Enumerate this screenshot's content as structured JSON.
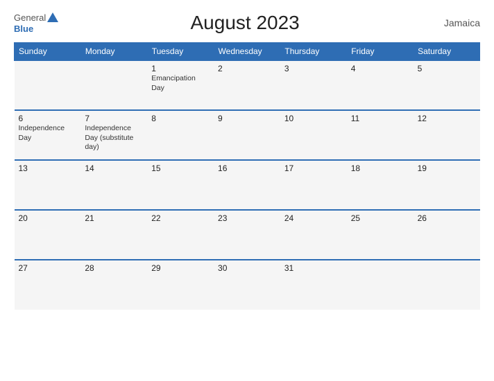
{
  "header": {
    "title": "August 2023",
    "country": "Jamaica",
    "logo_general": "General",
    "logo_blue": "Blue"
  },
  "weekdays": [
    "Sunday",
    "Monday",
    "Tuesday",
    "Wednesday",
    "Thursday",
    "Friday",
    "Saturday"
  ],
  "weeks": [
    [
      {
        "day": "",
        "holiday": ""
      },
      {
        "day": "",
        "holiday": ""
      },
      {
        "day": "1",
        "holiday": "Emancipation Day"
      },
      {
        "day": "2",
        "holiday": ""
      },
      {
        "day": "3",
        "holiday": ""
      },
      {
        "day": "4",
        "holiday": ""
      },
      {
        "day": "5",
        "holiday": ""
      }
    ],
    [
      {
        "day": "6",
        "holiday": "Independence Day"
      },
      {
        "day": "7",
        "holiday": "Independence Day (substitute day)"
      },
      {
        "day": "8",
        "holiday": ""
      },
      {
        "day": "9",
        "holiday": ""
      },
      {
        "day": "10",
        "holiday": ""
      },
      {
        "day": "11",
        "holiday": ""
      },
      {
        "day": "12",
        "holiday": ""
      }
    ],
    [
      {
        "day": "13",
        "holiday": ""
      },
      {
        "day": "14",
        "holiday": ""
      },
      {
        "day": "15",
        "holiday": ""
      },
      {
        "day": "16",
        "holiday": ""
      },
      {
        "day": "17",
        "holiday": ""
      },
      {
        "day": "18",
        "holiday": ""
      },
      {
        "day": "19",
        "holiday": ""
      }
    ],
    [
      {
        "day": "20",
        "holiday": ""
      },
      {
        "day": "21",
        "holiday": ""
      },
      {
        "day": "22",
        "holiday": ""
      },
      {
        "day": "23",
        "holiday": ""
      },
      {
        "day": "24",
        "holiday": ""
      },
      {
        "day": "25",
        "holiday": ""
      },
      {
        "day": "26",
        "holiday": ""
      }
    ],
    [
      {
        "day": "27",
        "holiday": ""
      },
      {
        "day": "28",
        "holiday": ""
      },
      {
        "day": "29",
        "holiday": ""
      },
      {
        "day": "30",
        "holiday": ""
      },
      {
        "day": "31",
        "holiday": ""
      },
      {
        "day": "",
        "holiday": ""
      },
      {
        "day": "",
        "holiday": ""
      }
    ]
  ]
}
